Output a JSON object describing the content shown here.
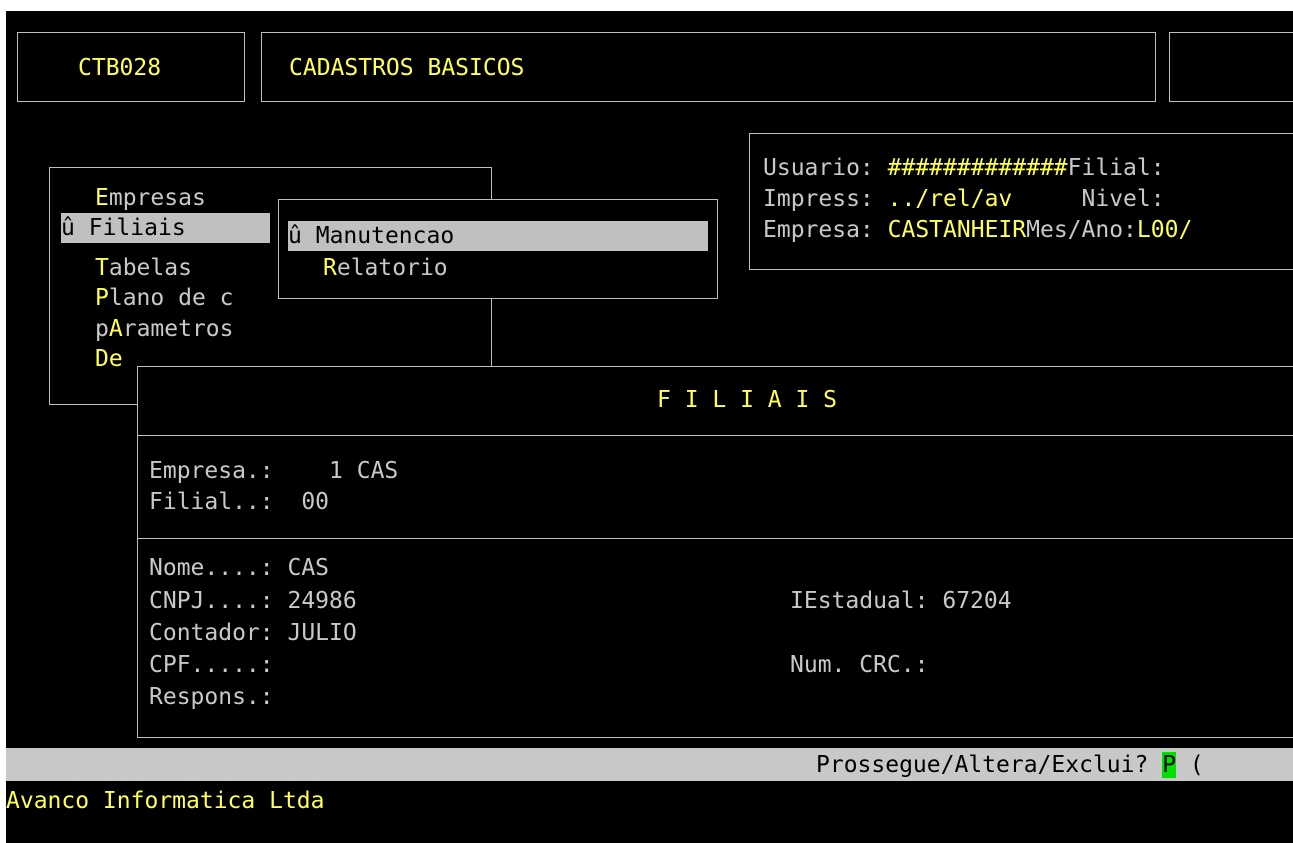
{
  "header": {
    "program_code": "CTB028",
    "module_title": "CADASTROS BASICOS"
  },
  "main_menu": {
    "items": [
      {
        "hotkey": "E",
        "rest": "mpresas"
      },
      {
        "marker": "û",
        "hotkey": "F",
        "rest": "iliais"
      },
      {
        "hotkey": "T",
        "rest": "abelas"
      },
      {
        "hotkey": "P",
        "rest": "lano de c"
      },
      {
        "prefix": "p",
        "hotkey": "A",
        "rest": "rametros"
      },
      {
        "hotkey": "De",
        "rest": ""
      }
    ]
  },
  "submenu": {
    "items": [
      {
        "marker": "û",
        "label": "Manutencao"
      },
      {
        "hotkey": "R",
        "rest": "elatorio"
      }
    ]
  },
  "info_panel": {
    "usuario_label": "Usuario:",
    "usuario_value": "#############",
    "filial_label": "Filial:",
    "impress_label": "Impress:",
    "impress_value": "../rel/av",
    "nivel_label": "Nivel:",
    "empresa_label": "Empresa:",
    "empresa_value": "CASTANHEIR",
    "mesano_label": "Mes/Ano:",
    "mesano_value": "L00/"
  },
  "form": {
    "title": "F I L I A I S",
    "empresa_label": "Empresa.:",
    "empresa_value": "  1 CAS",
    "filial_label": "Filial..:",
    "filial_value": "00",
    "nome_label": "Nome....:",
    "nome_value": "CAS",
    "cnpj_label": "CNPJ....:",
    "cnpj_value": "24986",
    "ie_label": "IEstadual:",
    "ie_value": "67204",
    "contador_label": "Contador:",
    "contador_value": "JULIO",
    "cpf_label": "CPF.....:",
    "crc_label": "Num. CRC.:",
    "respons_label": "Respons.:"
  },
  "status_bar": {
    "prompt": "Prossegue/Altera/Exclui?",
    "input_value": "P",
    "trailing": "("
  },
  "footer": {
    "company": "Avanco Informatica Ltda"
  },
  "colors": {
    "background": "#000000",
    "text": "#c8c8c8",
    "highlight": "#ffff54",
    "selection": "#c0c0c0",
    "status_bar": "#c8c8c8",
    "input_cursor": "#00e000"
  }
}
